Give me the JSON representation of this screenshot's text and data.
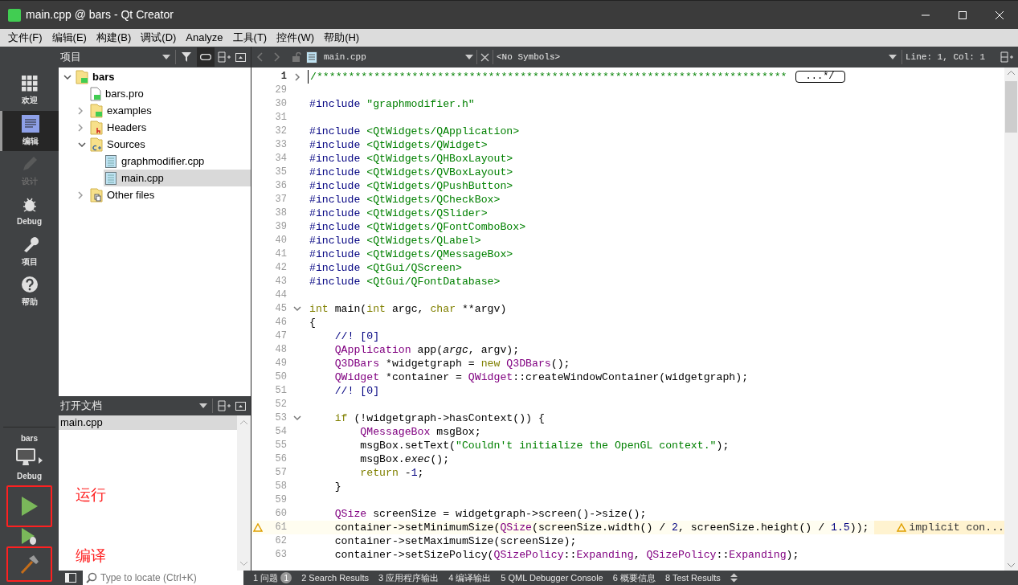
{
  "window": {
    "title": "main.cpp @ bars - Qt Creator"
  },
  "menu": [
    "文件(F)",
    "编辑(E)",
    "构建(B)",
    "调试(D)",
    "Analyze",
    "工具(T)",
    "控件(W)",
    "帮助(H)"
  ],
  "modes": [
    {
      "label": "欢迎",
      "kind": "welcome",
      "selected": false,
      "disabled": false
    },
    {
      "label": "编辑",
      "kind": "edit",
      "selected": true,
      "disabled": false
    },
    {
      "label": "设计",
      "kind": "design",
      "selected": false,
      "disabled": true
    },
    {
      "label": "Debug",
      "kind": "debug",
      "selected": false,
      "disabled": false
    },
    {
      "label": "项目",
      "kind": "projects",
      "selected": false,
      "disabled": false
    },
    {
      "label": "帮助",
      "kind": "help",
      "selected": false,
      "disabled": false
    }
  ],
  "target": {
    "project": "bars",
    "config": "Debug"
  },
  "run_controls": [
    {
      "kind": "run",
      "annotation": "运行"
    },
    {
      "kind": "debug_run"
    },
    {
      "kind": "build",
      "annotation": "编译"
    }
  ],
  "projects_pane": {
    "title": "项目",
    "tree": [
      {
        "label": "bars",
        "kind": "qt_folder",
        "expanded": true,
        "selected": false,
        "children": [
          {
            "label": "bars.pro",
            "kind": "pro_file",
            "selected": false
          },
          {
            "label": "examples",
            "kind": "qt_folder",
            "expanded": false,
            "selected": false
          },
          {
            "label": "Headers",
            "kind": "h_folder",
            "expanded": false,
            "selected": false
          },
          {
            "label": "Sources",
            "kind": "cpp_folder",
            "expanded": true,
            "selected": false,
            "children": [
              {
                "label": "graphmodifier.cpp",
                "kind": "cpp_file",
                "selected": false
              },
              {
                "label": "main.cpp",
                "kind": "cpp_file",
                "selected": true
              }
            ]
          },
          {
            "label": "Other files",
            "kind": "other_folder",
            "expanded": false,
            "selected": false
          }
        ]
      }
    ]
  },
  "open_documents": {
    "title": "打开文档",
    "items": [
      {
        "label": "main.cpp",
        "selected": true
      }
    ]
  },
  "editor_toolbar": {
    "file": "main.cpp",
    "symbols": "<No Symbols>",
    "position": "Line: 1, Col: 1"
  },
  "code": [
    {
      "n": "1",
      "expanded": false,
      "segs": [
        {
          "kind": "comment",
          "text": "/**************************************************************************"
        }
      ],
      "tail": "...*/"
    },
    {
      "n": "29"
    },
    {
      "n": "30",
      "segs": [
        {
          "kind": "pp",
          "text": "#include"
        },
        {
          "kind": "str",
          "text": " \"graphmodifier.h\""
        }
      ]
    },
    {
      "n": "31"
    },
    {
      "n": "32",
      "segs": [
        {
          "kind": "pp",
          "text": "#include"
        },
        {
          "kind": "str",
          "text": " <QtWidgets/QApplication>"
        }
      ]
    },
    {
      "n": "33",
      "segs": [
        {
          "kind": "pp",
          "text": "#include"
        },
        {
          "kind": "str",
          "text": " <QtWidgets/QWidget>"
        }
      ]
    },
    {
      "n": "34",
      "segs": [
        {
          "kind": "pp",
          "text": "#include"
        },
        {
          "kind": "str",
          "text": " <QtWidgets/QHBoxLayout>"
        }
      ]
    },
    {
      "n": "35",
      "segs": [
        {
          "kind": "pp",
          "text": "#include"
        },
        {
          "kind": "str",
          "text": " <QtWidgets/QVBoxLayout>"
        }
      ]
    },
    {
      "n": "36",
      "segs": [
        {
          "kind": "pp",
          "text": "#include"
        },
        {
          "kind": "str",
          "text": " <QtWidgets/QPushButton>"
        }
      ]
    },
    {
      "n": "37",
      "segs": [
        {
          "kind": "pp",
          "text": "#include"
        },
        {
          "kind": "str",
          "text": " <QtWidgets/QCheckBox>"
        }
      ]
    },
    {
      "n": "38",
      "segs": [
        {
          "kind": "pp",
          "text": "#include"
        },
        {
          "kind": "str",
          "text": " <QtWidgets/QSlider>"
        }
      ]
    },
    {
      "n": "39",
      "segs": [
        {
          "kind": "pp",
          "text": "#include"
        },
        {
          "kind": "str",
          "text": " <QtWidgets/QFontComboBox>"
        }
      ]
    },
    {
      "n": "40",
      "segs": [
        {
          "kind": "pp",
          "text": "#include"
        },
        {
          "kind": "str",
          "text": " <QtWidgets/QLabel>"
        }
      ]
    },
    {
      "n": "41",
      "segs": [
        {
          "kind": "pp",
          "text": "#include"
        },
        {
          "kind": "str",
          "text": " <QtWidgets/QMessageBox>"
        }
      ]
    },
    {
      "n": "42",
      "segs": [
        {
          "kind": "pp",
          "text": "#include"
        },
        {
          "kind": "str",
          "text": " <QtGui/QScreen>"
        }
      ]
    },
    {
      "n": "43",
      "segs": [
        {
          "kind": "pp",
          "text": "#include"
        },
        {
          "kind": "str",
          "text": " <QtGui/QFontDatabase>"
        }
      ]
    },
    {
      "n": "44"
    },
    {
      "n": "45",
      "expanded": true,
      "segs": [
        {
          "kind": "kw",
          "text": "int"
        },
        {
          "kind": "plain",
          "text": " main("
        },
        {
          "kind": "kw",
          "text": "int"
        },
        {
          "kind": "plain",
          "text": " argc, "
        },
        {
          "kind": "kw",
          "text": "char"
        },
        {
          "kind": "plain",
          "text": " **argv)"
        }
      ]
    },
    {
      "n": "46",
      "segs": [
        {
          "kind": "plain",
          "text": "{"
        }
      ]
    },
    {
      "n": "47",
      "segs": [
        {
          "kind": "doc",
          "text": "    //! [0]"
        }
      ]
    },
    {
      "n": "48",
      "segs": [
        {
          "kind": "type",
          "text": "    QApplication"
        },
        {
          "kind": "plain",
          "text": " app("
        },
        {
          "kind": "italic",
          "text": "argc"
        },
        {
          "kind": "plain",
          "text": ", argv);"
        }
      ]
    },
    {
      "n": "49",
      "segs": [
        {
          "kind": "type",
          "text": "    Q3DBars"
        },
        {
          "kind": "plain",
          "text": " *widgetgraph = "
        },
        {
          "kind": "kw",
          "text": "new"
        },
        {
          "kind": "type",
          "text": " Q3DBars"
        },
        {
          "kind": "plain",
          "text": "();"
        }
      ]
    },
    {
      "n": "50",
      "segs": [
        {
          "kind": "type",
          "text": "    QWidget"
        },
        {
          "kind": "plain",
          "text": " *container = "
        },
        {
          "kind": "type",
          "text": "QWidget"
        },
        {
          "kind": "plain",
          "text": "::createWindowContainer(widgetgraph);"
        }
      ]
    },
    {
      "n": "51",
      "segs": [
        {
          "kind": "doc",
          "text": "    //! [0]"
        }
      ]
    },
    {
      "n": "52"
    },
    {
      "n": "53",
      "expanded": true,
      "segs": [
        {
          "kind": "kw",
          "text": "    if"
        },
        {
          "kind": "plain",
          "text": " (!widgetgraph->hasContext()) {"
        }
      ]
    },
    {
      "n": "54",
      "segs": [
        {
          "kind": "type",
          "text": "        QMessageBox"
        },
        {
          "kind": "plain",
          "text": " msgBox;"
        }
      ]
    },
    {
      "n": "55",
      "segs": [
        {
          "kind": "plain",
          "text": "        msgBox.setText("
        },
        {
          "kind": "str",
          "text": "\"Couldn't initialize the OpenGL context.\""
        },
        {
          "kind": "plain",
          "text": ");"
        }
      ]
    },
    {
      "n": "56",
      "segs": [
        {
          "kind": "plain",
          "text": "        msgBox."
        },
        {
          "kind": "italic",
          "text": "exec"
        },
        {
          "kind": "plain",
          "text": "();"
        }
      ]
    },
    {
      "n": "57",
      "segs": [
        {
          "kind": "kw",
          "text": "        return"
        },
        {
          "kind": "plain",
          "text": " -"
        },
        {
          "kind": "num",
          "text": "1"
        },
        {
          "kind": "plain",
          "text": ";"
        }
      ]
    },
    {
      "n": "58",
      "segs": [
        {
          "kind": "plain",
          "text": "    }"
        }
      ]
    },
    {
      "n": "59"
    },
    {
      "n": "60",
      "segs": [
        {
          "kind": "type",
          "text": "    QSize"
        },
        {
          "kind": "plain",
          "text": " screenSize = widgetgraph->screen()->size();"
        }
      ]
    },
    {
      "n": "61",
      "warning": "implicit con...",
      "segs": [
        {
          "kind": "plain",
          "text": "    container->setMinimumSize("
        },
        {
          "kind": "type",
          "text": "QSize"
        },
        {
          "kind": "plain",
          "text": "(screenSize.width() / "
        },
        {
          "kind": "num",
          "text": "2"
        },
        {
          "kind": "plain",
          "text": ", screenSize.height() / "
        },
        {
          "kind": "num",
          "text": "1.5"
        },
        {
          "kind": "plain",
          "text": "));"
        }
      ]
    },
    {
      "n": "62",
      "segs": [
        {
          "kind": "plain",
          "text": "    container->setMaximumSize(screenSize);"
        }
      ]
    },
    {
      "n": "63",
      "segs": [
        {
          "kind": "plain",
          "text": "    container->setSizePolicy("
        },
        {
          "kind": "type",
          "text": "QSizePolicy"
        },
        {
          "kind": "plain",
          "text": "::"
        },
        {
          "kind": "type",
          "text": "Expanding"
        },
        {
          "kind": "plain",
          "text": ", "
        },
        {
          "kind": "type",
          "text": "QSizePolicy"
        },
        {
          "kind": "plain",
          "text": "::"
        },
        {
          "kind": "type",
          "text": "Expanding"
        },
        {
          "kind": "plain",
          "text": ");"
        }
      ]
    }
  ],
  "locator": {
    "placeholder": "Type to locate (Ctrl+K)"
  },
  "output_tabs": [
    {
      "label": "1 问题",
      "badge": "1"
    },
    {
      "label": "2 Search Results"
    },
    {
      "label": "3 应用程序输出"
    },
    {
      "label": "4 编译输出"
    },
    {
      "label": "5 QML Debugger Console"
    },
    {
      "label": "6 概要信息"
    },
    {
      "label": "8 Test Results"
    }
  ]
}
